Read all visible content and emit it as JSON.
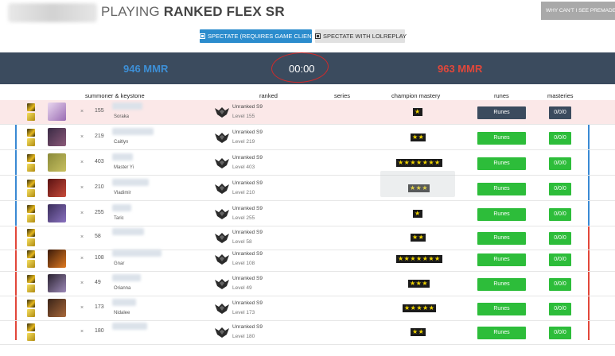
{
  "header": {
    "title_prefix": "PLAYING",
    "title_mode": "RANKED FLEX SR",
    "why_button": "WHY CAN'T I SEE PREMADES"
  },
  "actions": {
    "spectate_label": "SPECTATE (REQUIRES GAME CLIENT)",
    "lolreplay_label": "SPECTATE WITH LOLREPLAY"
  },
  "banner": {
    "blue_mmr": "946 MMR",
    "timer": "00:00",
    "red_mmr": "963 MMR"
  },
  "columns": {
    "summoner": "summoner & keystone",
    "ranked": "ranked",
    "series": "series",
    "mastery": "champion mastery",
    "runes": "runes",
    "masteries": "masteries"
  },
  "colors": {
    "blue_team": "#3a8ad4",
    "red_team": "#e2473a",
    "runes_green": "#2dbd3a",
    "banner_bg": "#3b4b5e"
  },
  "players": [
    {
      "level": "155",
      "champion": "Soraka",
      "rank": "Unranked S9",
      "rank_level": "Level 155",
      "mastery_stars": "★",
      "runes": "Runes",
      "masteries": "0/0/0"
    },
    {
      "level": "219",
      "champion": "Caitlyn",
      "rank": "Unranked S9",
      "rank_level": "Level 219",
      "mastery_stars": "★★",
      "runes": "Runes",
      "masteries": "0/0/0"
    },
    {
      "level": "403",
      "champion": "Master Yi",
      "rank": "Unranked S9",
      "rank_level": "Level 403",
      "mastery_stars": "★★★★★★★",
      "runes": "Runes",
      "masteries": "0/0/0"
    },
    {
      "level": "210",
      "champion": "Vladimir",
      "rank": "Unranked S9",
      "rank_level": "Level 210",
      "mastery_stars": "★★★",
      "runes": "Runes",
      "masteries": "0/0/0"
    },
    {
      "level": "255",
      "champion": "Taric",
      "rank": "Unranked S9",
      "rank_level": "Level 255",
      "mastery_stars": "★",
      "runes": "Runes",
      "masteries": "0/0/0"
    },
    {
      "level": "58",
      "champion": "",
      "rank": "Unranked S9",
      "rank_level": "Level 58",
      "mastery_stars": "★★",
      "runes": "Runes",
      "masteries": "0/0/0"
    },
    {
      "level": "108",
      "champion": "Gnar",
      "rank": "Unranked S9",
      "rank_level": "Level 108",
      "mastery_stars": "★★★★★★★",
      "runes": "Runes",
      "masteries": "0/0/0"
    },
    {
      "level": "49",
      "champion": "Orianna",
      "rank": "Unranked S9",
      "rank_level": "Level 49",
      "mastery_stars": "★★★",
      "runes": "Runes",
      "masteries": "0/0/0"
    },
    {
      "level": "173",
      "champion": "Nidalee",
      "rank": "Unranked S9",
      "rank_level": "Level 173",
      "mastery_stars": "★★★★★",
      "runes": "Runes",
      "masteries": "0/0/0"
    },
    {
      "level": "180",
      "champion": "",
      "rank": "Unranked S9",
      "rank_level": "Level 180",
      "mastery_stars": "★★",
      "runes": "Runes",
      "masteries": "0/0/0"
    }
  ]
}
